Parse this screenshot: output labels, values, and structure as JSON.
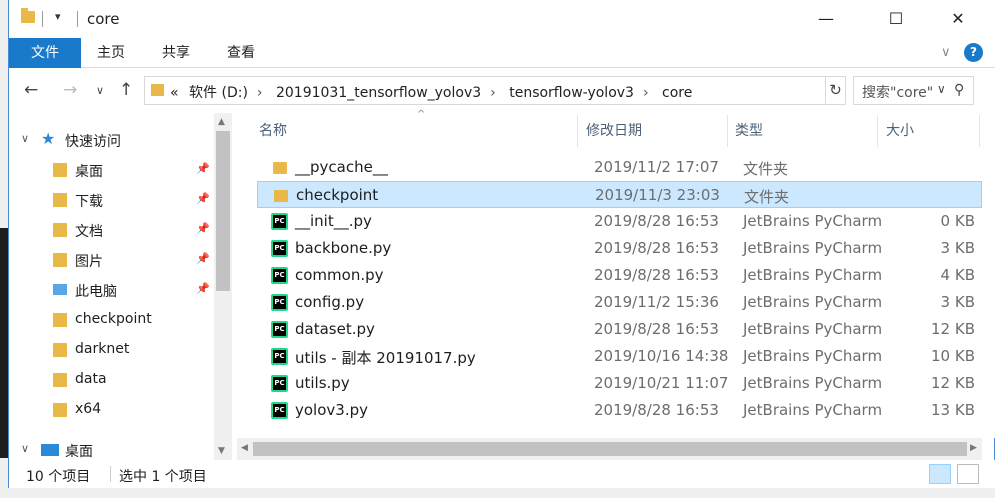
{
  "window": {
    "title": "core",
    "minimize": "—",
    "maximize": "☐",
    "close": "✕",
    "quick_access_arrow": "▾"
  },
  "ribbon": {
    "tabs": [
      "文件",
      "主页",
      "共享",
      "查看"
    ],
    "expand_icon": "chevron-down-icon",
    "help": "?"
  },
  "address": {
    "overflow": "«",
    "segments": [
      "软件 (D:)",
      "20191031_tensorflow_yolov3",
      "tensorflow-yolov3",
      "core"
    ],
    "search_placeholder": "搜索\"core\""
  },
  "nav": {
    "items": [
      {
        "label": "快速访问",
        "icon": "star-icon",
        "expander": "∨",
        "pinned": false
      },
      {
        "label": "桌面",
        "icon": "desktop-folder-icon",
        "pinned": true
      },
      {
        "label": "下载",
        "icon": "download-folder-icon",
        "pinned": true
      },
      {
        "label": "文档",
        "icon": "documents-folder-icon",
        "pinned": true
      },
      {
        "label": "图片",
        "icon": "pictures-folder-icon",
        "pinned": true
      },
      {
        "label": "此电脑",
        "icon": "computer-icon",
        "pinned": true
      },
      {
        "label": "checkpoint",
        "icon": "folder-icon",
        "pinned": false
      },
      {
        "label": "darknet",
        "icon": "folder-icon",
        "pinned": false
      },
      {
        "label": "data",
        "icon": "folder-icon",
        "pinned": false
      },
      {
        "label": "x64",
        "icon": "folder-icon",
        "pinned": false
      },
      {
        "label": "桌面",
        "icon": "desktop-icon",
        "expander": "∨",
        "pinned": false
      }
    ]
  },
  "list": {
    "headers": [
      "名称",
      "修改日期",
      "类型",
      "大小"
    ],
    "rows": [
      {
        "name": "__pycache__",
        "date": "2019/11/2 17:07",
        "type": "文件夹",
        "size": "",
        "kind": "folder",
        "selected": false
      },
      {
        "name": "checkpoint",
        "date": "2019/11/3 23:03",
        "type": "文件夹",
        "size": "",
        "kind": "folder",
        "selected": true
      },
      {
        "name": "__init__.py",
        "date": "2019/8/28 16:53",
        "type": "JetBrains PyCharm",
        "size": "0 KB",
        "kind": "py",
        "selected": false
      },
      {
        "name": "backbone.py",
        "date": "2019/8/28 16:53",
        "type": "JetBrains PyCharm",
        "size": "3 KB",
        "kind": "py",
        "selected": false
      },
      {
        "name": "common.py",
        "date": "2019/8/28 16:53",
        "type": "JetBrains PyCharm",
        "size": "4 KB",
        "kind": "py",
        "selected": false
      },
      {
        "name": "config.py",
        "date": "2019/11/2 15:36",
        "type": "JetBrains PyCharm",
        "size": "3 KB",
        "kind": "py",
        "selected": false
      },
      {
        "name": "dataset.py",
        "date": "2019/8/28 16:53",
        "type": "JetBrains PyCharm",
        "size": "12 KB",
        "kind": "py",
        "selected": false
      },
      {
        "name": "utils - 副本 20191017.py",
        "date": "2019/10/16 14:38",
        "type": "JetBrains PyCharm",
        "size": "10 KB",
        "kind": "py",
        "selected": false
      },
      {
        "name": "utils.py",
        "date": "2019/10/21 11:07",
        "type": "JetBrains PyCharm",
        "size": "12 KB",
        "kind": "py",
        "selected": false
      },
      {
        "name": "yolov3.py",
        "date": "2019/8/28 16:53",
        "type": "JetBrains PyCharm",
        "size": "13 KB",
        "kind": "py",
        "selected": false
      }
    ]
  },
  "status": {
    "count": "10 个项目",
    "selection": "选中 1 个项目"
  },
  "colors": {
    "accent": "#1979ca",
    "selection": "#cce8ff",
    "folder": "#e8b948",
    "pycharm": "#21d789"
  }
}
